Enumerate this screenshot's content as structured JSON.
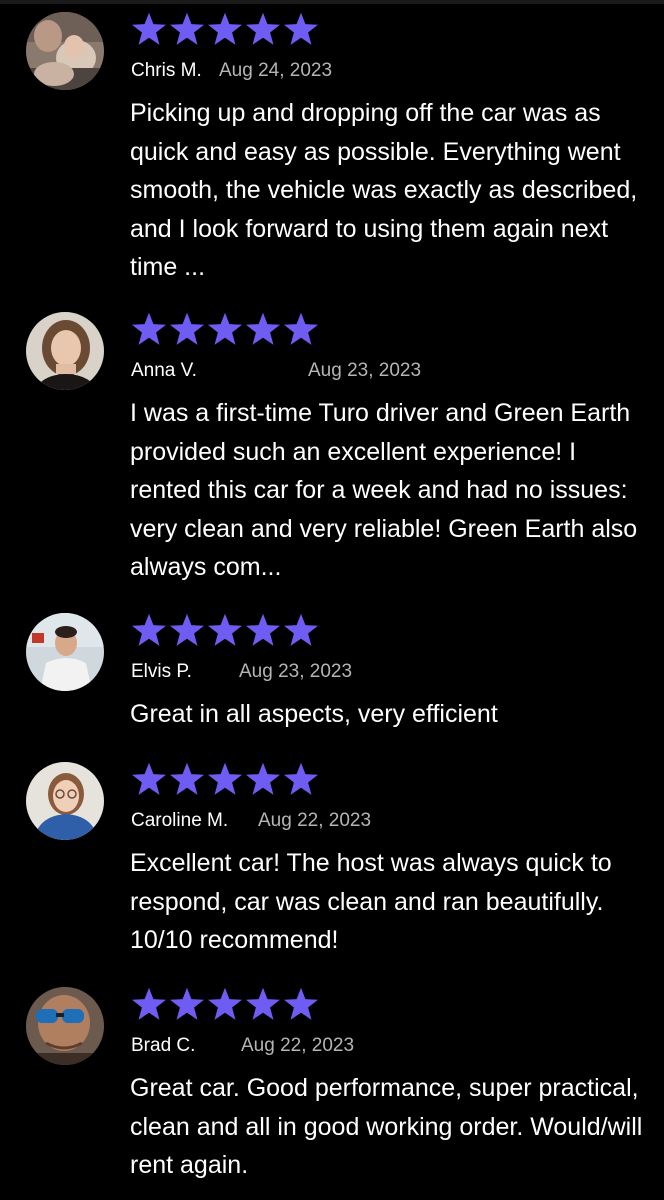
{
  "theme": {
    "background": "#000000",
    "star_color": "#6f5cf2",
    "text_color": "#ffffff",
    "date_color": "#b5b5b5"
  },
  "reviews": [
    {
      "name": "Chris M.",
      "date": "Aug 24, 2023",
      "rating": 5,
      "text": "Picking up and dropping off the car was as quick and easy as possible. Everything went smooth, the vehicle was exactly as described, and I look forward to using them again next time ...",
      "avatar_icon": "avatar-chris"
    },
    {
      "name": "Anna V.",
      "date": "Aug 23, 2023",
      "rating": 5,
      "text": "I was a first-time Turo driver and Green Earth provided such an excellent experience! I rented this car for a week and had no issues: very clean and very reliable! Green Earth also always com...",
      "avatar_icon": "avatar-anna"
    },
    {
      "name": "Elvis P.",
      "date": "Aug 23, 2023",
      "rating": 5,
      "text": "Great in all aspects, very efficient",
      "avatar_icon": "avatar-elvis"
    },
    {
      "name": "Caroline M.",
      "date": "Aug 22, 2023",
      "rating": 5,
      "text": "Excellent car! The host was always quick to respond, car was clean and ran beautifully. 10/10 recommend!",
      "avatar_icon": "avatar-caroline"
    },
    {
      "name": "Brad C.",
      "date": "Aug 22, 2023",
      "rating": 5,
      "text": "Great car. Good performance, super practical, clean and all in good working order. Would/will rent again.",
      "avatar_icon": "avatar-brad"
    }
  ]
}
